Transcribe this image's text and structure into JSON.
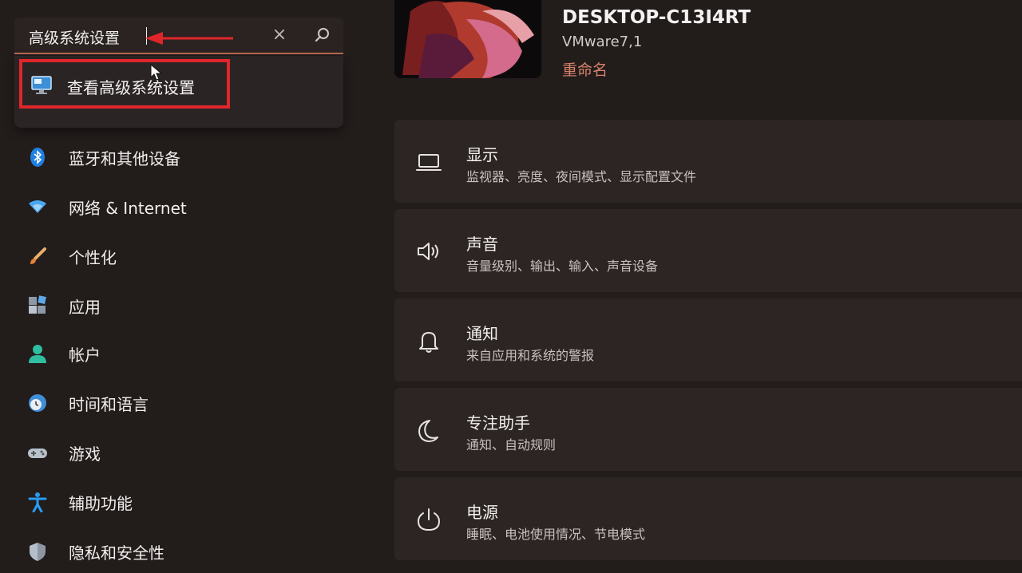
{
  "search": {
    "value": "高级系统设置",
    "clear_icon": "×"
  },
  "suggestion": {
    "label": "查看高级系统设置"
  },
  "sidebar": {
    "items": [
      {
        "label": "蓝牙和其他设备",
        "icon": "bluetooth-icon"
      },
      {
        "label": "网络 & Internet",
        "icon": "wifi-icon"
      },
      {
        "label": "个性化",
        "icon": "brush-icon"
      },
      {
        "label": "应用",
        "icon": "apps-icon"
      },
      {
        "label": "帐户",
        "icon": "account-icon"
      },
      {
        "label": "时间和语言",
        "icon": "globe-clock-icon"
      },
      {
        "label": "游戏",
        "icon": "gamepad-icon"
      },
      {
        "label": "辅助功能",
        "icon": "accessibility-icon"
      },
      {
        "label": "隐私和安全性",
        "icon": "shield-icon"
      }
    ]
  },
  "device": {
    "name": "DESKTOP-C13I4RT",
    "model": "VMware7,1",
    "rename": "重命名"
  },
  "cards": [
    {
      "title": "显示",
      "subtitle": "监视器、亮度、夜间模式、显示配置文件",
      "icon": "laptop-icon"
    },
    {
      "title": "声音",
      "subtitle": "音量级别、输出、输入、声音设备",
      "icon": "speaker-icon"
    },
    {
      "title": "通知",
      "subtitle": "来自应用和系统的警报",
      "icon": "bell-icon"
    },
    {
      "title": "专注助手",
      "subtitle": "通知、自动规则",
      "icon": "moon-icon"
    },
    {
      "title": "电源",
      "subtitle": "睡眠、电池使用情况、节电模式",
      "icon": "power-icon"
    }
  ],
  "colors": {
    "background": "#221c1b",
    "accent": "#d9826c",
    "highlight": "#e0262a"
  }
}
